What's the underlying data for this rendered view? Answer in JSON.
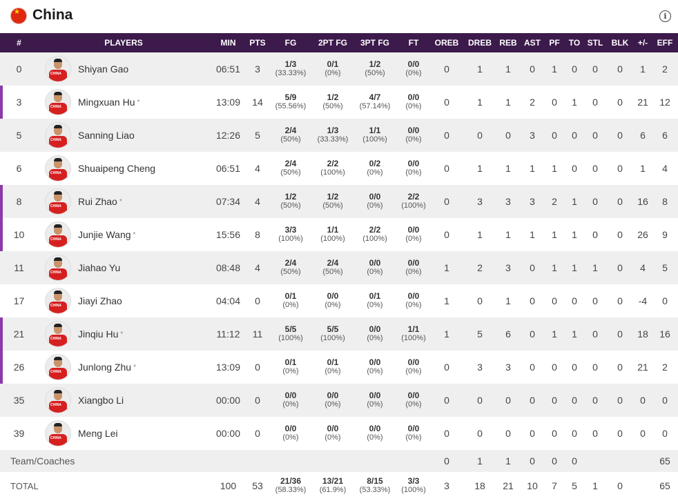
{
  "team": {
    "name": "China",
    "info_icon": "i"
  },
  "columns": [
    "#",
    "PLAYERS",
    "MIN",
    "PTS",
    "FG",
    "2PT FG",
    "3PT FG",
    "FT",
    "OREB",
    "DREB",
    "REB",
    "AST",
    "PF",
    "TO",
    "STL",
    "BLK",
    "+/-",
    "EFF"
  ],
  "players": [
    {
      "num": "0",
      "name": "Shiyan Gao",
      "starter": false,
      "min": "06:51",
      "pts": "3",
      "fg": [
        "1/3",
        "(33.33%)"
      ],
      "fg2": [
        "0/1",
        "(0%)"
      ],
      "fg3": [
        "1/2",
        "(50%)"
      ],
      "ft": [
        "0/0",
        "(0%)"
      ],
      "oreb": "0",
      "dreb": "1",
      "reb": "1",
      "ast": "0",
      "pf": "1",
      "to": "0",
      "stl": "0",
      "blk": "0",
      "pm": "1",
      "eff": "2"
    },
    {
      "num": "3",
      "name": "Mingxuan Hu",
      "starter": true,
      "min": "13:09",
      "pts": "14",
      "fg": [
        "5/9",
        "(55.56%)"
      ],
      "fg2": [
        "1/2",
        "(50%)"
      ],
      "fg3": [
        "4/7",
        "(57.14%)"
      ],
      "ft": [
        "0/0",
        "(0%)"
      ],
      "oreb": "0",
      "dreb": "1",
      "reb": "1",
      "ast": "2",
      "pf": "0",
      "to": "1",
      "stl": "0",
      "blk": "0",
      "pm": "21",
      "eff": "12"
    },
    {
      "num": "5",
      "name": "Sanning Liao",
      "starter": false,
      "min": "12:26",
      "pts": "5",
      "fg": [
        "2/4",
        "(50%)"
      ],
      "fg2": [
        "1/3",
        "(33.33%)"
      ],
      "fg3": [
        "1/1",
        "(100%)"
      ],
      "ft": [
        "0/0",
        "(0%)"
      ],
      "oreb": "0",
      "dreb": "0",
      "reb": "0",
      "ast": "3",
      "pf": "0",
      "to": "0",
      "stl": "0",
      "blk": "0",
      "pm": "6",
      "eff": "6"
    },
    {
      "num": "6",
      "name": "Shuaipeng Cheng",
      "starter": false,
      "min": "06:51",
      "pts": "4",
      "fg": [
        "2/4",
        "(50%)"
      ],
      "fg2": [
        "2/2",
        "(100%)"
      ],
      "fg3": [
        "0/2",
        "(0%)"
      ],
      "ft": [
        "0/0",
        "(0%)"
      ],
      "oreb": "0",
      "dreb": "1",
      "reb": "1",
      "ast": "1",
      "pf": "1",
      "to": "0",
      "stl": "0",
      "blk": "0",
      "pm": "1",
      "eff": "4"
    },
    {
      "num": "8",
      "name": "Rui Zhao",
      "starter": true,
      "min": "07:34",
      "pts": "4",
      "fg": [
        "1/2",
        "(50%)"
      ],
      "fg2": [
        "1/2",
        "(50%)"
      ],
      "fg3": [
        "0/0",
        "(0%)"
      ],
      "ft": [
        "2/2",
        "(100%)"
      ],
      "oreb": "0",
      "dreb": "3",
      "reb": "3",
      "ast": "3",
      "pf": "2",
      "to": "1",
      "stl": "0",
      "blk": "0",
      "pm": "16",
      "eff": "8"
    },
    {
      "num": "10",
      "name": "Junjie Wang",
      "starter": true,
      "min": "15:56",
      "pts": "8",
      "fg": [
        "3/3",
        "(100%)"
      ],
      "fg2": [
        "1/1",
        "(100%)"
      ],
      "fg3": [
        "2/2",
        "(100%)"
      ],
      "ft": [
        "0/0",
        "(0%)"
      ],
      "oreb": "0",
      "dreb": "1",
      "reb": "1",
      "ast": "1",
      "pf": "1",
      "to": "1",
      "stl": "0",
      "blk": "0",
      "pm": "26",
      "eff": "9"
    },
    {
      "num": "11",
      "name": "Jiahao Yu",
      "starter": false,
      "min": "08:48",
      "pts": "4",
      "fg": [
        "2/4",
        "(50%)"
      ],
      "fg2": [
        "2/4",
        "(50%)"
      ],
      "fg3": [
        "0/0",
        "(0%)"
      ],
      "ft": [
        "0/0",
        "(0%)"
      ],
      "oreb": "1",
      "dreb": "2",
      "reb": "3",
      "ast": "0",
      "pf": "1",
      "to": "1",
      "stl": "1",
      "blk": "0",
      "pm": "4",
      "eff": "5"
    },
    {
      "num": "17",
      "name": "Jiayi Zhao",
      "starter": false,
      "min": "04:04",
      "pts": "0",
      "fg": [
        "0/1",
        "(0%)"
      ],
      "fg2": [
        "0/0",
        "(0%)"
      ],
      "fg3": [
        "0/1",
        "(0%)"
      ],
      "ft": [
        "0/0",
        "(0%)"
      ],
      "oreb": "1",
      "dreb": "0",
      "reb": "1",
      "ast": "0",
      "pf": "0",
      "to": "0",
      "stl": "0",
      "blk": "0",
      "pm": "-4",
      "eff": "0"
    },
    {
      "num": "21",
      "name": "Jinqiu Hu",
      "starter": true,
      "min": "11:12",
      "pts": "11",
      "fg": [
        "5/5",
        "(100%)"
      ],
      "fg2": [
        "5/5",
        "(100%)"
      ],
      "fg3": [
        "0/0",
        "(0%)"
      ],
      "ft": [
        "1/1",
        "(100%)"
      ],
      "oreb": "1",
      "dreb": "5",
      "reb": "6",
      "ast": "0",
      "pf": "1",
      "to": "1",
      "stl": "0",
      "blk": "0",
      "pm": "18",
      "eff": "16"
    },
    {
      "num": "26",
      "name": "Junlong Zhu",
      "starter": true,
      "min": "13:09",
      "pts": "0",
      "fg": [
        "0/1",
        "(0%)"
      ],
      "fg2": [
        "0/1",
        "(0%)"
      ],
      "fg3": [
        "0/0",
        "(0%)"
      ],
      "ft": [
        "0/0",
        "(0%)"
      ],
      "oreb": "0",
      "dreb": "3",
      "reb": "3",
      "ast": "0",
      "pf": "0",
      "to": "0",
      "stl": "0",
      "blk": "0",
      "pm": "21",
      "eff": "2"
    },
    {
      "num": "35",
      "name": "Xiangbo Li",
      "starter": false,
      "min": "00:00",
      "pts": "0",
      "fg": [
        "0/0",
        "(0%)"
      ],
      "fg2": [
        "0/0",
        "(0%)"
      ],
      "fg3": [
        "0/0",
        "(0%)"
      ],
      "ft": [
        "0/0",
        "(0%)"
      ],
      "oreb": "0",
      "dreb": "0",
      "reb": "0",
      "ast": "0",
      "pf": "0",
      "to": "0",
      "stl": "0",
      "blk": "0",
      "pm": "0",
      "eff": "0"
    },
    {
      "num": "39",
      "name": "Meng Lei",
      "starter": false,
      "min": "00:00",
      "pts": "0",
      "fg": [
        "0/0",
        "(0%)"
      ],
      "fg2": [
        "0/0",
        "(0%)"
      ],
      "fg3": [
        "0/0",
        "(0%)"
      ],
      "ft": [
        "0/0",
        "(0%)"
      ],
      "oreb": "0",
      "dreb": "0",
      "reb": "0",
      "ast": "0",
      "pf": "0",
      "to": "0",
      "stl": "0",
      "blk": "0",
      "pm": "0",
      "eff": "0"
    }
  ],
  "team_row": {
    "label": "Team/Coaches",
    "min": "",
    "pts": "",
    "fg": [
      "",
      ""
    ],
    "fg2": [
      "",
      ""
    ],
    "fg3": [
      "",
      ""
    ],
    "ft": [
      "",
      ""
    ],
    "oreb": "0",
    "dreb": "1",
    "reb": "1",
    "ast": "0",
    "pf": "0",
    "to": "0",
    "stl": "",
    "blk": "",
    "pm": "",
    "eff": "65"
  },
  "total_row": {
    "label": "TOTAL",
    "min": "100",
    "pts": "53",
    "fg": [
      "21/36",
      "(58.33%)"
    ],
    "fg2": [
      "13/21",
      "(61.9%)"
    ],
    "fg3": [
      "8/15",
      "(53.33%)"
    ],
    "ft": [
      "3/3",
      "(100%)"
    ],
    "oreb": "3",
    "dreb": "18",
    "reb": "21",
    "ast": "10",
    "pf": "7",
    "to": "5",
    "stl": "1",
    "blk": "0",
    "pm": "",
    "eff": "65"
  },
  "colors": {
    "header_bg": "#3c1a4b",
    "starter_bar": "#8b3aa8",
    "flag_red": "#de2910"
  }
}
